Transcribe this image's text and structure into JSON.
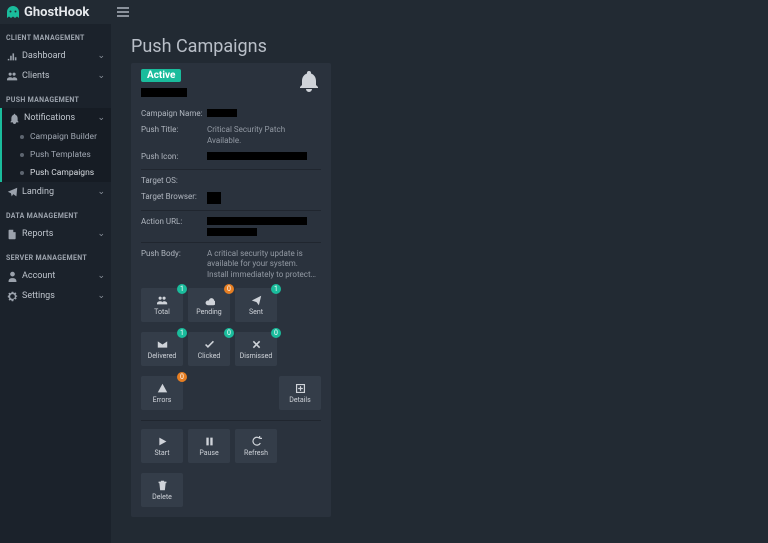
{
  "brand": "GhostHook",
  "page_title": "Push Campaigns",
  "sidebar": {
    "sections": [
      {
        "header": "CLIENT MANAGEMENT",
        "items": [
          {
            "icon": "chart-bar",
            "label": "Dashboard",
            "collapsible": true
          },
          {
            "icon": "users",
            "label": "Clients",
            "collapsible": true
          }
        ]
      },
      {
        "header": "PUSH MANAGEMENT",
        "items": [
          {
            "icon": "bell",
            "label": "Notifications",
            "collapsible": true,
            "expanded": true,
            "children": [
              {
                "label": "Campaign Builder"
              },
              {
                "label": "Push Templates"
              },
              {
                "label": "Push Campaigns",
                "active": true
              }
            ]
          },
          {
            "icon": "plane",
            "label": "Landing",
            "collapsible": true
          }
        ]
      },
      {
        "header": "DATA MANAGEMENT",
        "items": [
          {
            "icon": "doc",
            "label": "Reports",
            "collapsible": true
          }
        ]
      },
      {
        "header": "SERVER MANAGEMENT",
        "items": [
          {
            "icon": "user",
            "label": "Account",
            "collapsible": true
          },
          {
            "icon": "gear",
            "label": "Settings",
            "collapsible": true
          }
        ]
      }
    ]
  },
  "card": {
    "status": "Active",
    "fields": {
      "campaign_name_label": "Campaign Name:",
      "push_title_label": "Push Title:",
      "push_title_value": "Critical Security Patch Available.",
      "push_icon_label": "Push Icon:",
      "target_os_label": "Target OS:",
      "target_browser_label": "Target Browser:",
      "action_url_label": "Action URL:",
      "push_body_label": "Push Body:",
      "push_body_value": "A critical security update is available for your system. Install immediately to protect your system from potential security threats."
    },
    "stats": [
      {
        "name": "total",
        "label": "Total",
        "icon": "users2",
        "count": "1",
        "color": "teal"
      },
      {
        "name": "pending",
        "label": "Pending",
        "icon": "cloud",
        "count": "0",
        "color": "orange"
      },
      {
        "name": "sent",
        "label": "Sent",
        "icon": "send",
        "count": "1",
        "color": "teal"
      },
      {
        "name": "delivered",
        "label": "Delivered",
        "icon": "mail",
        "count": "1",
        "color": "teal"
      },
      {
        "name": "clicked",
        "label": "Clicked",
        "icon": "check",
        "count": "0",
        "color": "teal"
      },
      {
        "name": "dismissed",
        "label": "Dismissed",
        "icon": "x",
        "count": "0",
        "color": "teal"
      },
      {
        "name": "errors",
        "label": "Errors",
        "icon": "warn",
        "count": "0",
        "color": "orange"
      },
      {
        "name": "details",
        "label": "Details",
        "icon": "plus"
      }
    ],
    "actions": [
      {
        "name": "start",
        "label": "Start",
        "icon": "play"
      },
      {
        "name": "pause",
        "label": "Pause",
        "icon": "pause"
      },
      {
        "name": "refresh",
        "label": "Refresh",
        "icon": "refresh"
      },
      {
        "name": "delete",
        "label": "Delete",
        "icon": "trash"
      }
    ]
  }
}
